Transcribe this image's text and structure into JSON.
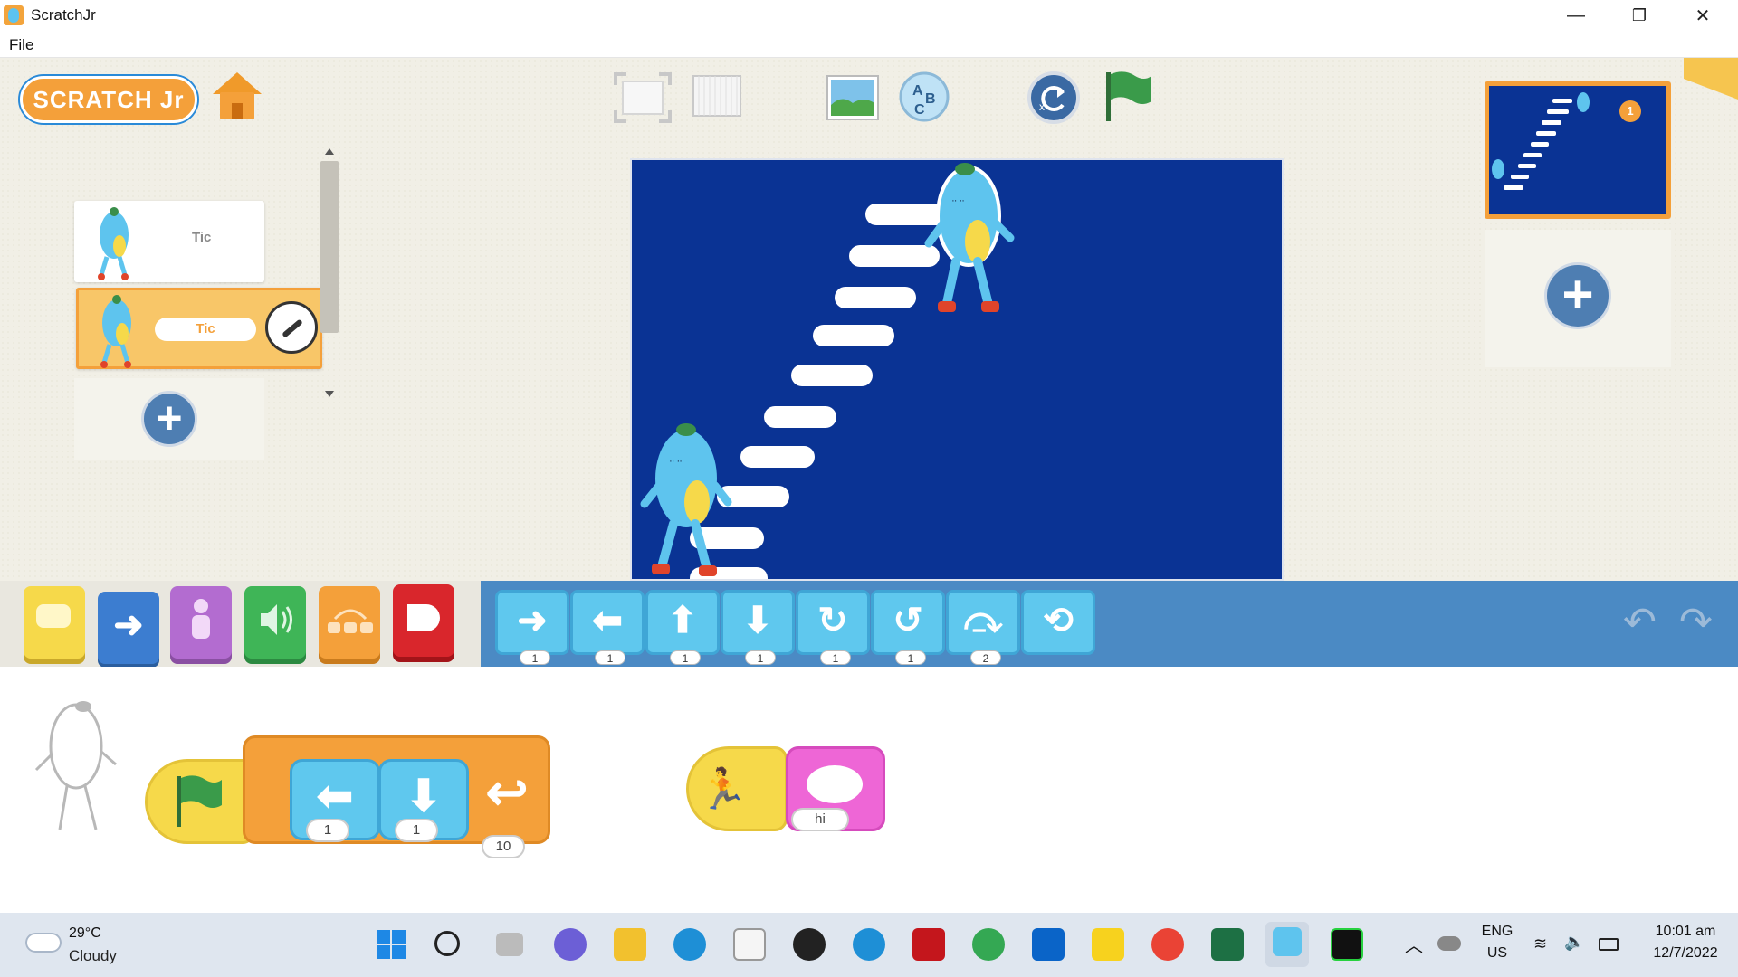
{
  "window": {
    "title": "ScratchJr",
    "minimize": "—",
    "restore": "❐",
    "close": "✕"
  },
  "menu": {
    "file": "File"
  },
  "header": {
    "logo_text": "SCRATCH Jr"
  },
  "sprites": [
    {
      "name": "Tic",
      "selected": false
    },
    {
      "name": "Tic",
      "selected": true
    }
  ],
  "add_sprite": "+",
  "pages": {
    "current_page_number": "1",
    "add_page": "+"
  },
  "categories": [
    {
      "name": "triggering",
      "color": "#f6d94a"
    },
    {
      "name": "motion",
      "color": "#3c7dd0"
    },
    {
      "name": "looks",
      "color": "#b36cd0"
    },
    {
      "name": "sound",
      "color": "#3fb557"
    },
    {
      "name": "control",
      "color": "#f4a03a"
    },
    {
      "name": "end",
      "color": "#d9262c"
    }
  ],
  "motion_blocks": [
    {
      "name": "move-right",
      "glyph": "➜",
      "value": "1"
    },
    {
      "name": "move-left",
      "glyph": "⬅",
      "value": "1"
    },
    {
      "name": "move-up",
      "glyph": "⬆",
      "value": "1"
    },
    {
      "name": "move-down",
      "glyph": "⬇",
      "value": "1"
    },
    {
      "name": "turn-right",
      "glyph": "↻",
      "value": "1"
    },
    {
      "name": "turn-left",
      "glyph": "↺",
      "value": "1"
    },
    {
      "name": "hop",
      "glyph": "⤼",
      "value": "2"
    },
    {
      "name": "go-home",
      "glyph": "⟲",
      "value": ""
    }
  ],
  "undo": "↶",
  "redo": "↷",
  "script1": {
    "move_left_value": "1",
    "move_down_value": "1",
    "repeat_value": "10"
  },
  "script2": {
    "say_value": "hi"
  },
  "taskbar": {
    "weather_temp": "29°C",
    "weather_desc": "Cloudy",
    "lang_top": "ENG",
    "lang_bottom": "US",
    "time": "10:01 am",
    "date": "12/7/2022"
  }
}
